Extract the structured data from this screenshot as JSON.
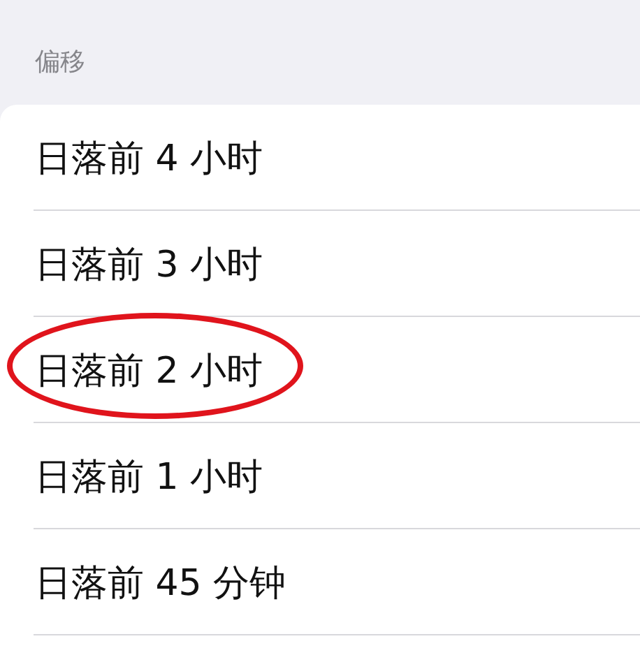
{
  "section": {
    "header": "偏移"
  },
  "rows": [
    {
      "label": "日落前 4 小时",
      "circled": false
    },
    {
      "label": "日落前 3 小时",
      "circled": false
    },
    {
      "label": "日落前 2 小时",
      "circled": true
    },
    {
      "label": "日落前 1 小时",
      "circled": false
    },
    {
      "label": "日落前 45 分钟",
      "circled": false
    }
  ]
}
